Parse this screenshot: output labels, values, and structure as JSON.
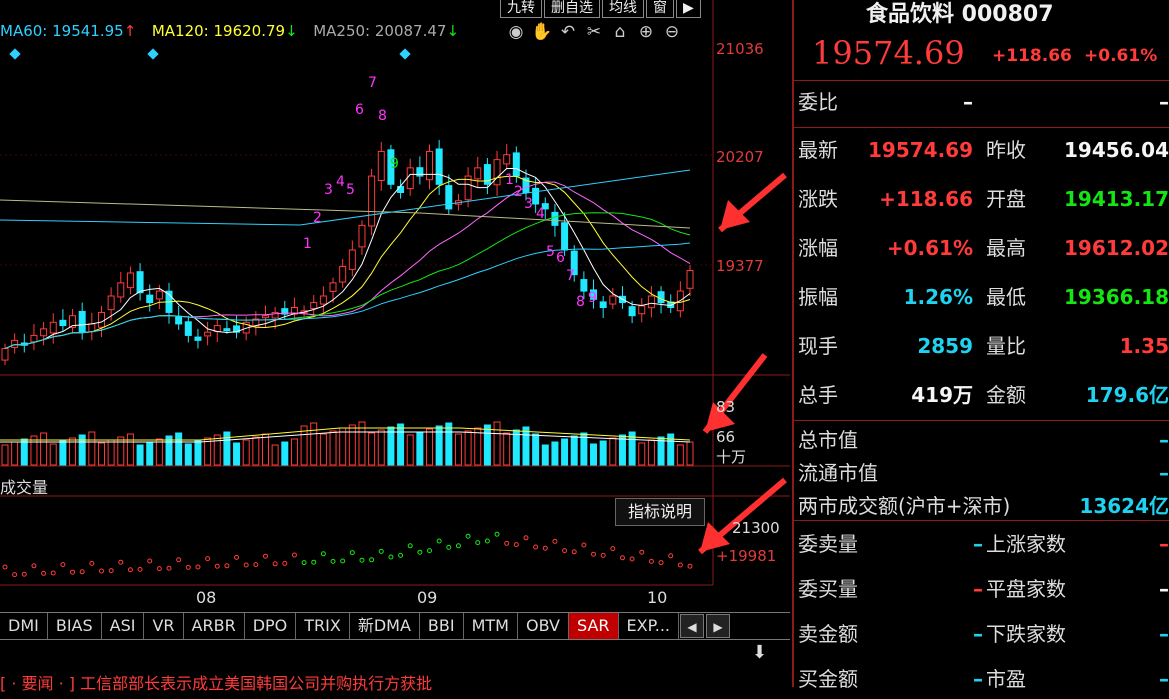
{
  "toolbar": {
    "items": [
      "九转",
      "删自选",
      "均线",
      "窗",
      "▶"
    ]
  },
  "ma": [
    {
      "label": "MA60: 19541.95",
      "arrow": "↑",
      "color": "#2fd0ff",
      "arrow_color": "#ff3b3b"
    },
    {
      "label": "MA120: 19620.79",
      "arrow": "↓",
      "color": "#ffff33",
      "arrow_color": "#14e614"
    },
    {
      "label": "MA250: 20087.47",
      "arrow": "↓",
      "color": "#aaaaaa",
      "arrow_color": "#14e614"
    }
  ],
  "chart_icons": [
    "eye-icon",
    "hand-icon",
    "undo-icon",
    "scissors-icon",
    "lock-icon",
    "zoom-in-icon",
    "zoom-out-icon"
  ],
  "price_axis": [
    "21036",
    "20207",
    "19377"
  ],
  "volume_axis": [
    "83",
    "66",
    "十万"
  ],
  "volume_label": "成交量",
  "indicator_button": "指标说明",
  "sar_axis": [
    "21300",
    "+19981"
  ],
  "date_labels": [
    "08",
    "09",
    "10"
  ],
  "tabs": [
    "DMI",
    "BIAS",
    "ASI",
    "VR",
    "ARBR",
    "DPO",
    "TRIX",
    "新DMA",
    "BBI",
    "MTM",
    "OBV",
    "SAR",
    "EXP..."
  ],
  "active_tab": "SAR",
  "news": "[ · 要闻 · ] 工信部部长表示成立美国韩国公司并购执行方获批",
  "stock": {
    "title": "食品饮料 000807",
    "price": "19574.69",
    "change": "+118.66",
    "change_pct": "+0.61%"
  },
  "quote_rows": [
    {
      "l1": "委比",
      "v1": "–",
      "c1": "white",
      "l2": "",
      "v2": "–",
      "c2": "white"
    },
    {
      "l1": "最新",
      "v1": "19574.69",
      "c1": "red",
      "l2": "昨收",
      "v2": "19456.04",
      "c2": "white"
    },
    {
      "l1": "涨跌",
      "v1": "+118.66",
      "c1": "red",
      "l2": "开盘",
      "v2": "19413.17",
      "c2": "green"
    },
    {
      "l1": "涨幅",
      "v1": "+0.61%",
      "c1": "red",
      "l2": "最高",
      "v2": "19612.02",
      "c2": "red"
    },
    {
      "l1": "振幅",
      "v1": "1.26%",
      "c1": "cyan",
      "l2": "最低",
      "v2": "19366.18",
      "c2": "green"
    },
    {
      "l1": "现手",
      "v1": "2859",
      "c1": "cyan",
      "l2": "量比",
      "v2": "1.35",
      "c2": "red"
    },
    {
      "l1": "总手",
      "v1": "419万",
      "c1": "white",
      "l2": "金额",
      "v2": "179.6亿",
      "c2": "cyan"
    }
  ],
  "market_rows": [
    {
      "label": "总市值",
      "value": "–"
    },
    {
      "label": "流通市值",
      "value": "–"
    },
    {
      "label": "两市成交额(沪市+深市)",
      "value": "13624亿"
    }
  ],
  "order_rows": [
    {
      "l1": "委卖量",
      "v1": "–",
      "l2": "上涨家数",
      "v2": "–"
    },
    {
      "l1": "委买量",
      "v1": "–",
      "l2": "平盘家数",
      "v2": "–"
    },
    {
      "l1": "卖金额",
      "v1": "–",
      "l2": "下跌家数",
      "v2": "–"
    },
    {
      "l1": "买金额",
      "v1": "–",
      "l2": "市盈",
      "v2": "–"
    }
  ],
  "chart_data": {
    "type": "candlestick",
    "title": "",
    "ylim": [
      19000,
      21100
    ],
    "x_ticks": [
      "08",
      "09",
      "10"
    ],
    "closes": [
      19100,
      19150,
      19120,
      19180,
      19220,
      19260,
      19240,
      19300,
      19200,
      19250,
      19320,
      19420,
      19500,
      19560,
      19440,
      19380,
      19450,
      19320,
      19250,
      19180,
      19150,
      19200,
      19240,
      19220,
      19200,
      19260,
      19280,
      19300,
      19320,
      19310,
      19350,
      19330,
      19380,
      19420,
      19500,
      19600,
      19700,
      19850,
      20150,
      20300,
      20100,
      20050,
      20200,
      20150,
      20300,
      20100,
      19950,
      20000,
      20150,
      20200,
      20100,
      20250,
      20280,
      20150,
      20050,
      19980,
      19950,
      19850,
      19700,
      19550,
      19450,
      19400,
      19350,
      19420,
      19380,
      19300,
      19360,
      19420,
      19380,
      19350,
      19450,
      19575
    ],
    "sar_markers": [
      "1",
      "2",
      "3",
      "4",
      "5",
      "6",
      "7",
      "8",
      "9",
      "1",
      "2",
      "3",
      "4",
      "5",
      "6",
      "7",
      "8",
      "9"
    ]
  }
}
